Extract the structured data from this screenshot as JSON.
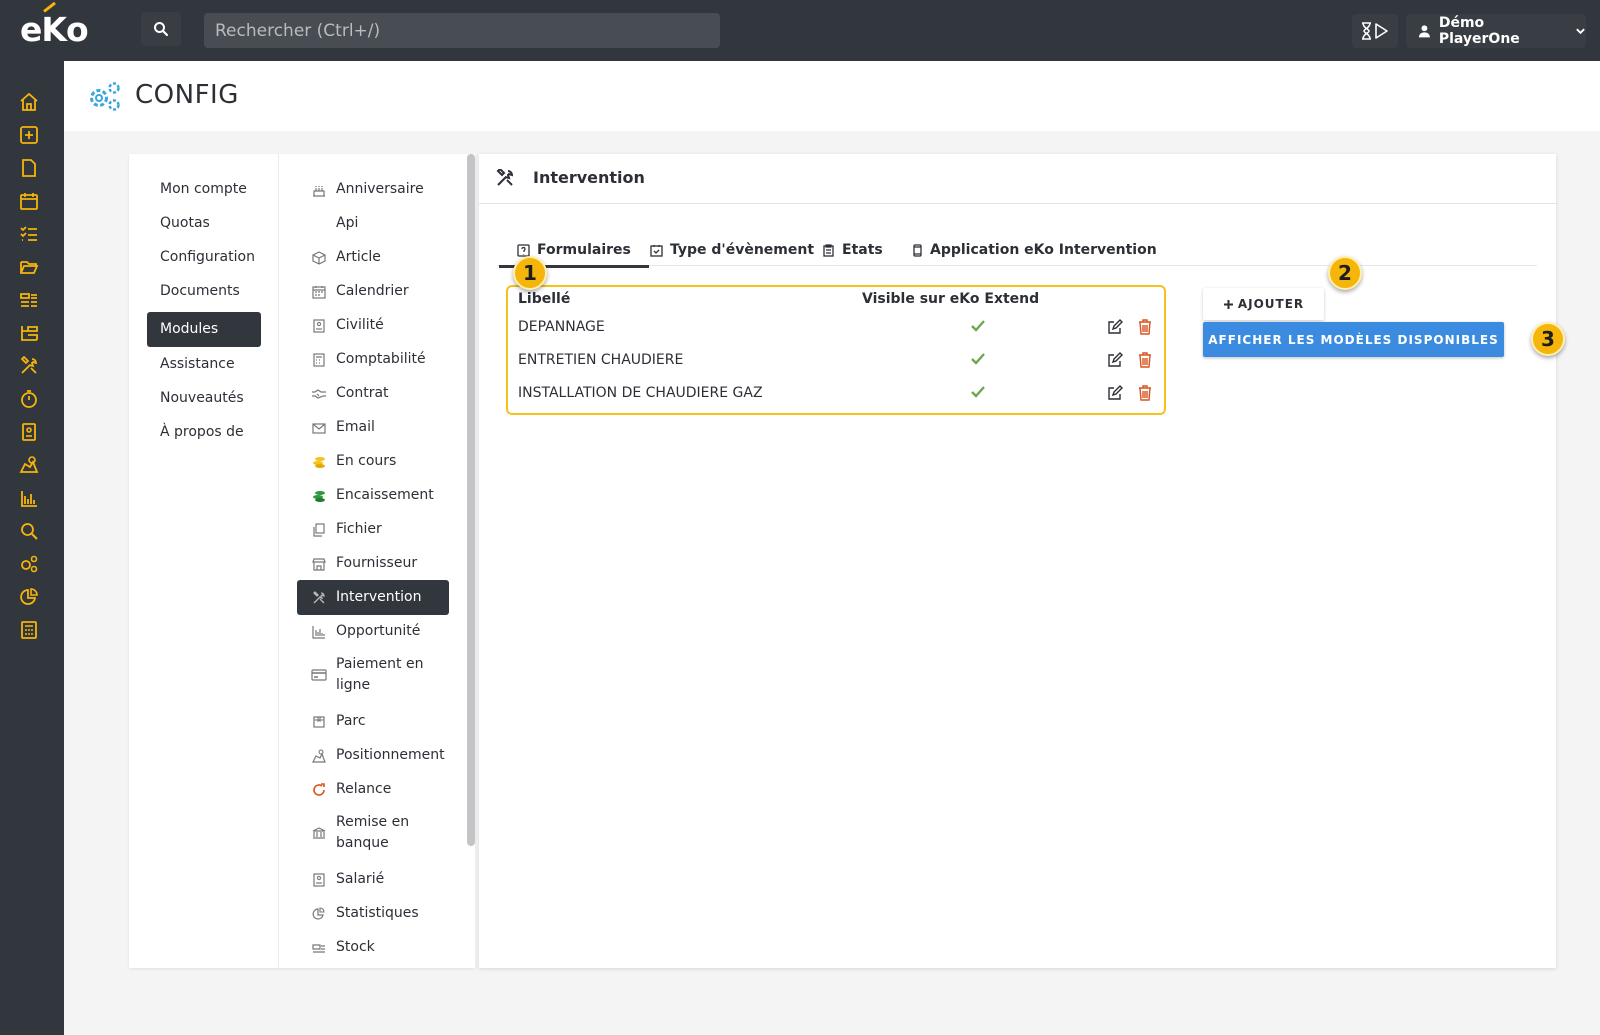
{
  "app": {
    "logo": "eKo"
  },
  "topbar": {
    "search_placeholder": "Rechercher (Ctrl+/)",
    "user_name": "Démo PlayerOne"
  },
  "rail": {
    "icons": [
      "home-icon",
      "plus-square-icon",
      "file-icon",
      "calendar-icon",
      "checklist-icon",
      "folder-open-icon",
      "tasks-icon",
      "sitemap-icon",
      "tools-icon",
      "stopwatch-icon",
      "badge-icon",
      "map-icon",
      "bar-chart-icon",
      "search-icon",
      "cogs-icon",
      "pie-chart-icon",
      "calculator-icon"
    ]
  },
  "page": {
    "title": "CONFIG"
  },
  "menu1": {
    "items": [
      "Mon compte",
      "Quotas",
      "Configuration",
      "Documents",
      "Modules",
      "Assistance",
      "Nouveautés",
      "À propos de"
    ],
    "active": "Modules"
  },
  "menu2": {
    "items": [
      "Anniversaire",
      "Api",
      "Article",
      "Calendrier",
      "Civilité",
      "Comptabilité",
      "Contrat",
      "Email",
      "En cours",
      "Encaissement",
      "Fichier",
      "Fournisseur",
      "Intervention",
      "Opportunité",
      "Paiement en ligne",
      "Parc",
      "Positionnement",
      "Relance",
      "Remise en banque",
      "Salarié",
      "Statistiques",
      "Stock"
    ],
    "active": "Intervention"
  },
  "panel": {
    "title": "Intervention",
    "tabs": [
      "Formulaires",
      "Type d'évènement",
      "Etats",
      "Application eKo Intervention"
    ],
    "active_tab": "Formulaires",
    "table": {
      "headers": [
        "Libellé",
        "Visible sur eKo Extend"
      ],
      "rows": [
        {
          "label": "DEPANNAGE",
          "visible": true
        },
        {
          "label": "ENTRETIEN CHAUDIERE",
          "visible": true
        },
        {
          "label": "INSTALLATION DE CHAUDIERE GAZ",
          "visible": true
        }
      ]
    },
    "add_button": "AJOUTER",
    "models_button": "AFFICHER LES MODÈLES DISPONIBLES"
  },
  "badges": [
    "1",
    "2",
    "3"
  ],
  "colors": {
    "accent": "#f5b50a",
    "primary": "#3b8be0",
    "dark": "#32363d",
    "check": "#6aa84f",
    "delete": "#d9531e"
  }
}
